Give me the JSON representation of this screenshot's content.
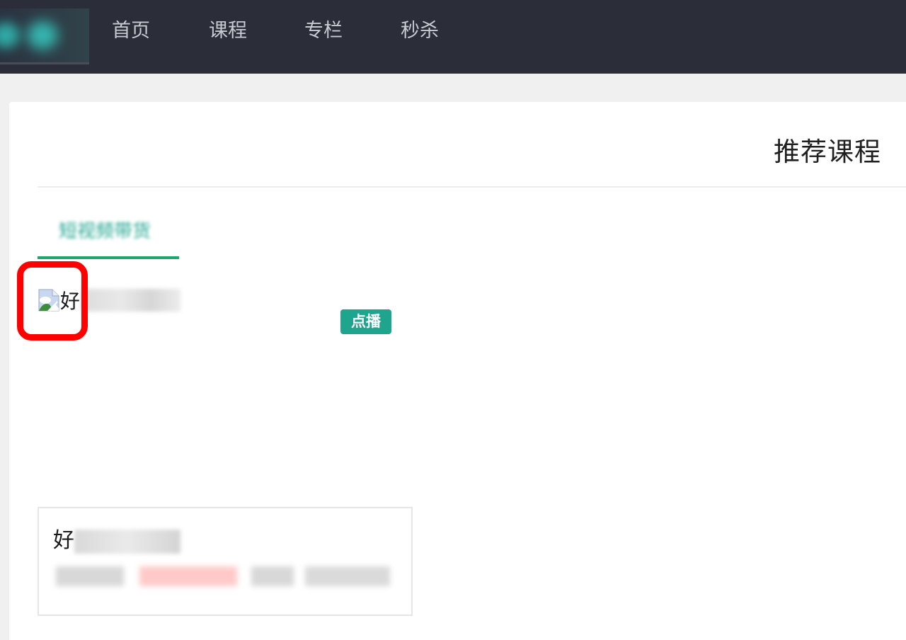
{
  "nav": {
    "items": [
      "首页",
      "课程",
      "专栏",
      "秒杀"
    ]
  },
  "recommend": {
    "section_title": "推荐课程",
    "tab_label": "短视频带货",
    "thumbnail_alt_start": "好",
    "badge_label": "点播",
    "course_title_start": "好"
  },
  "colors": {
    "topbar": "#2b2d39",
    "accent": "#1fa58e",
    "highlight": "#ff0000"
  }
}
